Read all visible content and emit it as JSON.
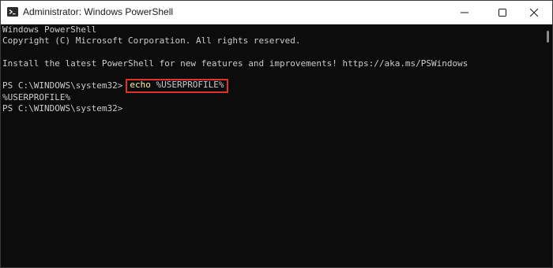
{
  "window": {
    "title": "Administrator: Windows PowerShell",
    "controls": {
      "minimize": "minimize",
      "maximize": "maximize",
      "close": "close"
    }
  },
  "console": {
    "lines": [
      "Windows PowerShell",
      "Copyright (C) Microsoft Corporation. All rights reserved.",
      "",
      "Install the latest PowerShell for new features and improvements! https://aka.ms/PSWindows",
      ""
    ],
    "prompt": "PS C:\\WINDOWS\\system32>",
    "command": {
      "cmdlet": "echo",
      "argument": "%USERPROFILE%"
    },
    "output": "%USERPROFILE%",
    "final_prompt": "PS C:\\WINDOWS\\system32>"
  },
  "colors": {
    "console_bg": "#0c0c0c",
    "console_text": "#cccccc",
    "command_highlight": "#f9f1a5",
    "annotation_border": "#e03131"
  }
}
